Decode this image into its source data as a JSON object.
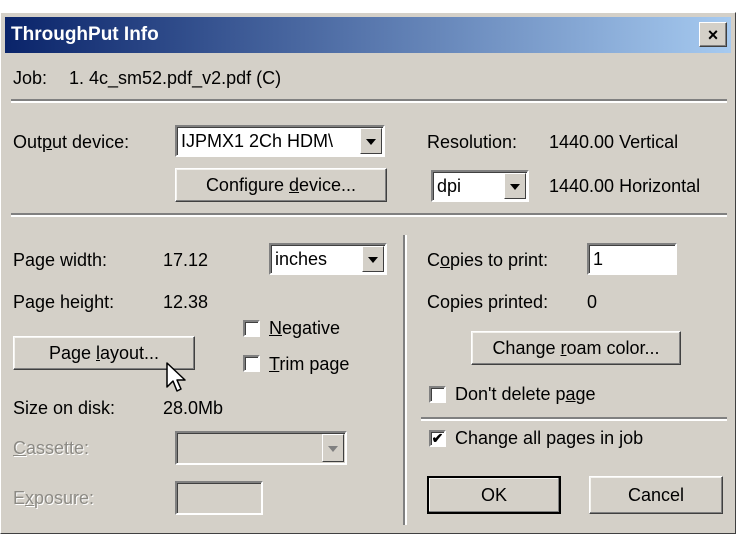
{
  "window": {
    "title": "ThroughPut Info",
    "close_label": "×"
  },
  "job": {
    "label": "Job:",
    "value": "1. 4c_sm52.pdf_v2.pdf (C)"
  },
  "output": {
    "label_pre": "Out",
    "label_ul": "p",
    "label_post": "ut device:",
    "device": "IJPMX1 2Ch HDM\\",
    "configure_pre": "Configure ",
    "configure_ul": "d",
    "configure_post": "evice..."
  },
  "resolution": {
    "label": "Resolution:",
    "vertical": "1440.00 Vertical",
    "horizontal": "1440.00 Horizontal",
    "unit": "dpi"
  },
  "page": {
    "width_label": "Page width:",
    "width_value": "17.12",
    "units": "inches",
    "height_label": "Page height:",
    "height_value": "12.38",
    "layout_pre": "Page ",
    "layout_ul": "l",
    "layout_post": "ayout...",
    "negative_ul": "N",
    "negative_post": "egative",
    "trim_ul": "T",
    "trim_post": "rim page",
    "size_label": "Size on disk:",
    "size_value": "28.0Mb",
    "cassette_ul": "C",
    "cassette_post": "assette:",
    "exposure_pre": "E",
    "exposure_ul": "x",
    "exposure_post": "posure:"
  },
  "copies": {
    "to_print_pre": "C",
    "to_print_ul": "o",
    "to_print_post": "pies to print:",
    "to_print_value": "1",
    "printed_label": "Copies printed:",
    "printed_value": "0",
    "roam_pre": "Change ",
    "roam_ul": "r",
    "roam_post": "oam color...",
    "dont_delete_pre": "Don't delete p",
    "dont_delete_ul": "a",
    "dont_delete_post": "ge",
    "change_all_label": "Change all pages in job",
    "change_all_mark": "✔"
  },
  "buttons": {
    "ok": "OK",
    "cancel": "Cancel"
  }
}
